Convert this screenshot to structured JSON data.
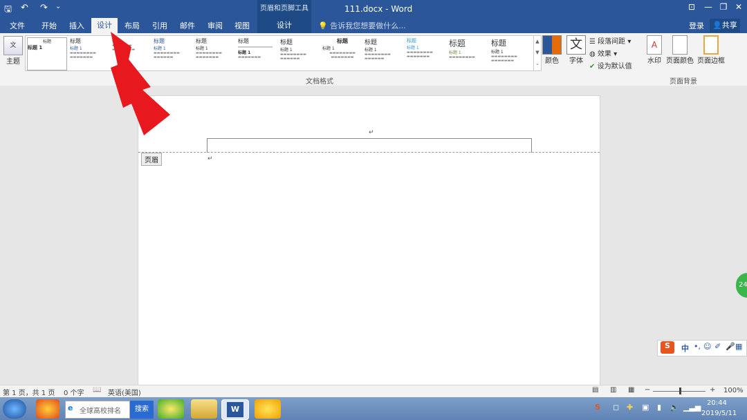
{
  "titlebar": {
    "context_tools": "页眉和页脚工具",
    "title": "111.docx - Word",
    "help": "?",
    "ribbon_display": "⊡",
    "minimize": "—",
    "restore": "❐",
    "close": "✕"
  },
  "quick_access": {
    "save": "🖫",
    "undo": "↶",
    "redo": "↷",
    "customize": "⌄"
  },
  "tabs": [
    {
      "label": "文件"
    },
    {
      "label": "开始"
    },
    {
      "label": "插入"
    },
    {
      "label": "设计"
    },
    {
      "label": "布局"
    },
    {
      "label": "引用"
    },
    {
      "label": "邮件"
    },
    {
      "label": "审阅"
    },
    {
      "label": "视图"
    }
  ],
  "context_tab": "设计",
  "tell_me": "告诉我您想要做什么...",
  "account": {
    "login": "登录",
    "share": "共享"
  },
  "ribbon": {
    "theme_label": "主题",
    "gallery_title": "标题",
    "gallery_subtitle": "标题 1",
    "styles_group_label": "文档格式",
    "colors_label": "颜色",
    "fonts_label": "字体",
    "fonts_glyph": "文",
    "para_spacing": "段落间距",
    "effects": "效果",
    "set_default": "设为默认值",
    "watermark": "水印",
    "page_color": "页面颜色",
    "page_border": "页面边框",
    "bg_group_label": "页面背景"
  },
  "document": {
    "header_tag": "页眉",
    "para_mark": "↵"
  },
  "status": {
    "page": "第 1 页，共 1 页",
    "words": "0 个字",
    "language": "英语(美国)",
    "zoom": "100%"
  },
  "taskbar": {
    "search_text": "全球高校排名",
    "search_button": "搜索",
    "time": "20:44",
    "date": "2019/5/11"
  },
  "ime": {
    "mode": "中",
    "logo": "S"
  },
  "badge": "24",
  "colors": {
    "brand": "#2b579a",
    "arrow": "#e8191e"
  }
}
